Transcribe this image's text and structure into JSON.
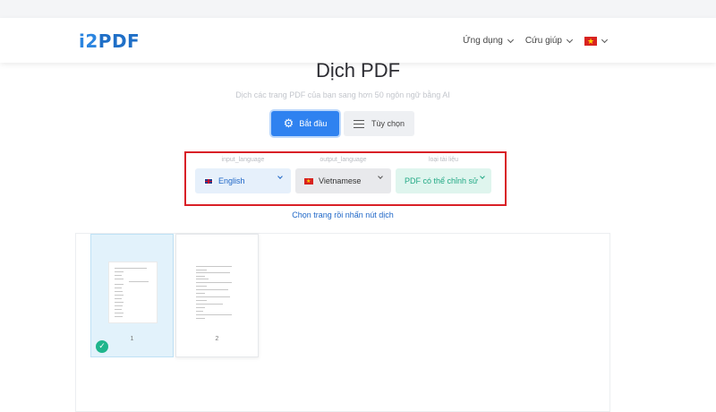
{
  "header": {
    "logo_prefix": "i2",
    "logo_suffix": "PDF",
    "nav": [
      {
        "label": "Ứng dụng"
      },
      {
        "label": "Cứu giúp"
      }
    ],
    "language_flag": "vn-flag-icon"
  },
  "main": {
    "title": "Dịch PDF",
    "subtitle": "Dịch các trang PDF của bạn sang hơn 50 ngôn ngữ bằng AI",
    "start_button": "Bắt đầu",
    "options_button": "Tùy chọn"
  },
  "selectors": {
    "input": {
      "label": "input_language",
      "value": "English",
      "flag": "uk-flag-icon"
    },
    "output": {
      "label": "output_language",
      "value": "Vietnamese",
      "flag": "vn-flag-icon"
    },
    "doctype": {
      "label": "loại tài liệu",
      "value": "PDF có thể chỉnh sử"
    }
  },
  "hint": "Chọn trang rồi nhấn nút dịch",
  "pages": [
    {
      "number": "1",
      "selected": true
    },
    {
      "number": "2",
      "selected": false
    }
  ],
  "colors": {
    "accent": "#2f82f0",
    "highlight_box": "#d92027",
    "success": "#1fb58c",
    "doctype_text": "#22a985"
  }
}
